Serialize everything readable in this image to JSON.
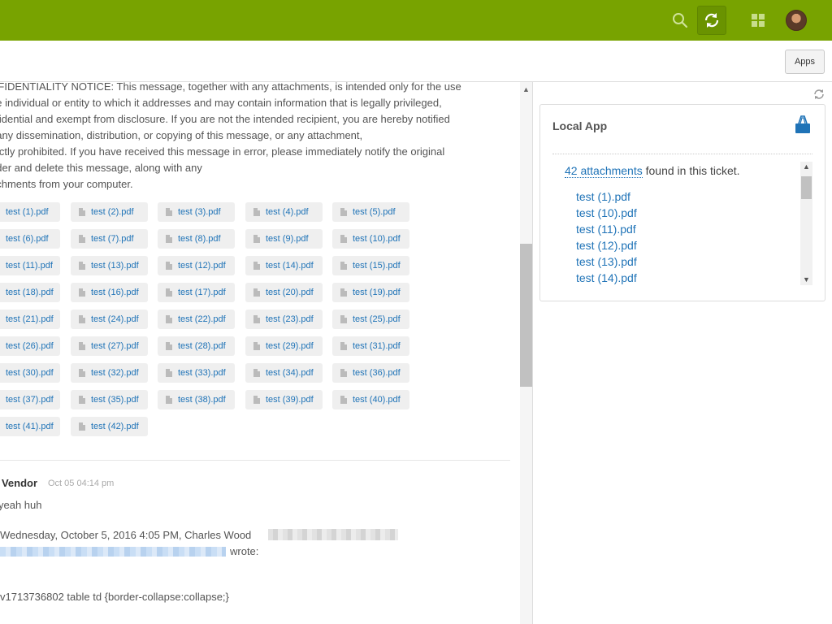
{
  "topbar": {
    "search_icon": "search-icon",
    "refresh_icon": "refresh-icon",
    "apps_grid_icon": "grid-icon",
    "avatar": "avatar",
    "bg_color": "#78a300"
  },
  "subbar": {
    "apps_label": "Apps"
  },
  "message": {
    "notice_lines": [
      "NFIDENTIALITY NOTICE: This message, together with any attachments, is intended only for the use",
      "he individual or entity to which it addresses and may contain information that is legally privileged,",
      "nfidential and exempt from disclosure. If you are not the intended recipient, you are hereby notified",
      "t any dissemination, distribution, or copying of this message, or any attachment,",
      "trictly prohibited. If you have received this message in error, please immediately notify the original",
      "nder and delete this message, along with any",
      "achments from your computer."
    ],
    "attachments": [
      "test (1).pdf",
      "test (2).pdf",
      "test (3).pdf",
      "test (4).pdf",
      "test (5).pdf",
      "test (6).pdf",
      "test (7).pdf",
      "test (8).pdf",
      "test (9).pdf",
      "test (10).pdf",
      "test (11).pdf",
      "test (13).pdf",
      "test (12).pdf",
      "test (14).pdf",
      "test (15).pdf",
      "test (18).pdf",
      "test (16).pdf",
      "test (17).pdf",
      "test (20).pdf",
      "test (19).pdf",
      "test (21).pdf",
      "test (24).pdf",
      "test (22).pdf",
      "test (23).pdf",
      "test (25).pdf",
      "test (26).pdf",
      "test (27).pdf",
      "test (28).pdf",
      "test (29).pdf",
      "test (31).pdf",
      "test (30).pdf",
      "test (32).pdf",
      "test (33).pdf",
      "test (34).pdf",
      "test (36).pdf",
      "test (37).pdf",
      "test (35).pdf",
      "test (38).pdf",
      "test (39).pdf",
      "test (40).pdf",
      "test (41).pdf",
      "test (42).pdf"
    ]
  },
  "reply": {
    "author": "t Vendor",
    "timestamp": "Oct 05 04:14 pm",
    "line1": "yeah huh",
    "line2": "Wednesday, October 5, 2016 4:05 PM, Charles Wood",
    "line3": "wrote:",
    "line4": "v1713736802 table td {border-collapse:collapse;}"
  },
  "app_panel": {
    "title": "Local App",
    "attachment_count_link": "42 attachments",
    "attachment_count_suffix": " found in this ticket.",
    "files": [
      "test (1).pdf",
      "test (10).pdf",
      "test (11).pdf",
      "test (12).pdf",
      "test (13).pdf",
      "test (14).pdf"
    ]
  }
}
